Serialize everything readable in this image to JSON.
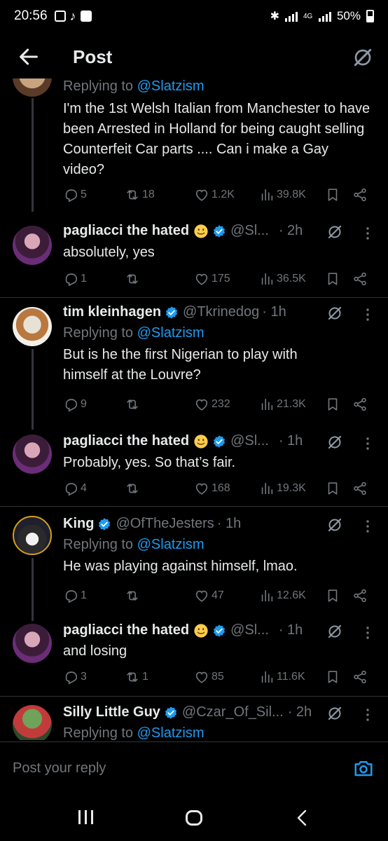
{
  "status_bar": {
    "time": "20:56",
    "battery": "50%",
    "network": "4G"
  },
  "header": {
    "title": "Post"
  },
  "tweets": [
    {
      "reply_prefix": "Replying to ",
      "reply_to": "@Slatzism",
      "text": "I'm the 1st Welsh Italian from Manchester to have been Arrested in Holland for being caught selling Counterfeit Car parts .... Can i make a Gay video?",
      "replies": "5",
      "reposts": "18",
      "likes": "1.2K",
      "views": "39.8K"
    },
    {
      "name": "pagliacci the hated",
      "handle": "@Sl...",
      "time": "· 2h",
      "text": "absolutely, yes",
      "replies": "1",
      "reposts": "",
      "likes": "175",
      "views": "36.5K"
    },
    {
      "name": "tim kleinhagen",
      "handle": "@Tkrinedog",
      "time": "· 1h",
      "reply_prefix": "Replying to ",
      "reply_to": "@Slatzism",
      "text": "But is he the first Nigerian to play with himself at the Louvre?",
      "replies": "9",
      "reposts": "",
      "likes": "232",
      "views": "21.3K"
    },
    {
      "name": "pagliacci the hated",
      "handle": "@Sl...",
      "time": "· 1h",
      "text": "Probably, yes. So that’s fair.",
      "replies": "4",
      "reposts": "",
      "likes": "168",
      "views": "19.3K"
    },
    {
      "name": "King",
      "handle": "@OfTheJesters",
      "time": "· 1h",
      "reply_prefix": "Replying to ",
      "reply_to": "@Slatzism",
      "text": "He was playing against himself, lmao.",
      "replies": "1",
      "reposts": "",
      "likes": "47",
      "views": "12.6K"
    },
    {
      "name": "pagliacci the hated",
      "handle": "@Sl...",
      "time": "· 1h",
      "text": "and losing",
      "replies": "3",
      "reposts": "1",
      "likes": "85",
      "views": "11.6K"
    },
    {
      "name": "Silly Little Guy",
      "handle": "@Czar_Of_Sil...",
      "time": "· 2h",
      "reply_prefix": "Replying to ",
      "reply_to": "@Slatzism"
    }
  ],
  "composer": {
    "placeholder": "Post your reply"
  },
  "colors": {
    "accent": "#1d9bf0",
    "muted": "#71767b",
    "text": "#e7e9ea",
    "background": "#000000"
  }
}
